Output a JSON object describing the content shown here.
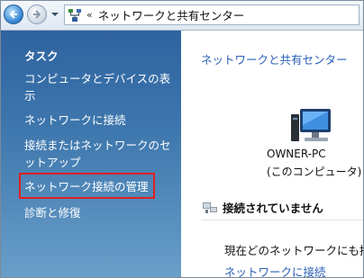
{
  "address_bar": {
    "chevron": "«",
    "breadcrumb": "ネットワークと共有センター"
  },
  "sidebar": {
    "title": "タスク",
    "tasks": [
      {
        "label": "コンピュータとデバイスの表示"
      },
      {
        "label": "ネットワークに接続"
      },
      {
        "label": "接続またはネットワークのセットアップ"
      },
      {
        "label": "ネットワーク接続の管理"
      },
      {
        "label": "診断と修復"
      }
    ]
  },
  "main": {
    "title": "ネットワークと共有センター",
    "computer_name": "OWNER-PC",
    "computer_sub": "(このコンピュータ)",
    "status": "接続されていません",
    "text": "現在どのネットワークにも接",
    "link": "ネットワークに接続"
  },
  "colors": {
    "sidebar_top": "#2f63a0",
    "link": "#2a5fb5",
    "highlight": "#e02020"
  },
  "icons": [
    "back-arrow-icon",
    "forward-arrow-icon",
    "dropdown-arrow-icon",
    "network-center-icon",
    "computer-icon",
    "network-disconnected-icon"
  ]
}
